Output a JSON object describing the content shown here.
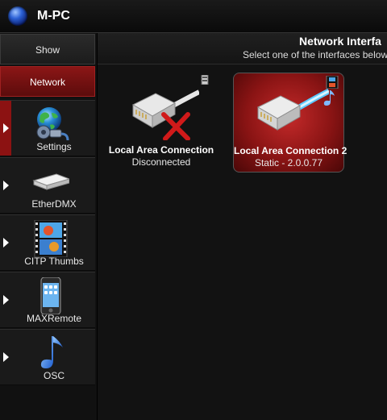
{
  "app": {
    "title": "M-PC"
  },
  "sidebar": {
    "buttons": [
      {
        "label": "Show",
        "active": false
      },
      {
        "label": "Network",
        "active": true
      }
    ],
    "items": [
      {
        "label": "Settings",
        "icon": "globe-gear-icon",
        "active": true
      },
      {
        "label": "EtherDMX",
        "icon": "network-device-icon",
        "active": false
      },
      {
        "label": "CITP Thumbs",
        "icon": "film-strip-icon",
        "active": false
      },
      {
        "label": "MAXRemote",
        "icon": "phone-icon",
        "active": false
      },
      {
        "label": "OSC",
        "icon": "music-note-icon",
        "active": false
      }
    ]
  },
  "main": {
    "title": "Network Interfa",
    "subtitle": "Select one of the interfaces below",
    "interfaces": [
      {
        "name": "Local Area Connection",
        "status": "Disconnected",
        "selected": false,
        "icon": "ethernet-disconnected-icon"
      },
      {
        "name": "Local Area Connection 2",
        "status": "Static - 2.0.0.77",
        "selected": true,
        "icon": "ethernet-connected-icon"
      }
    ]
  },
  "colors": {
    "accent_red": "#8b1616",
    "background": "#000000"
  }
}
